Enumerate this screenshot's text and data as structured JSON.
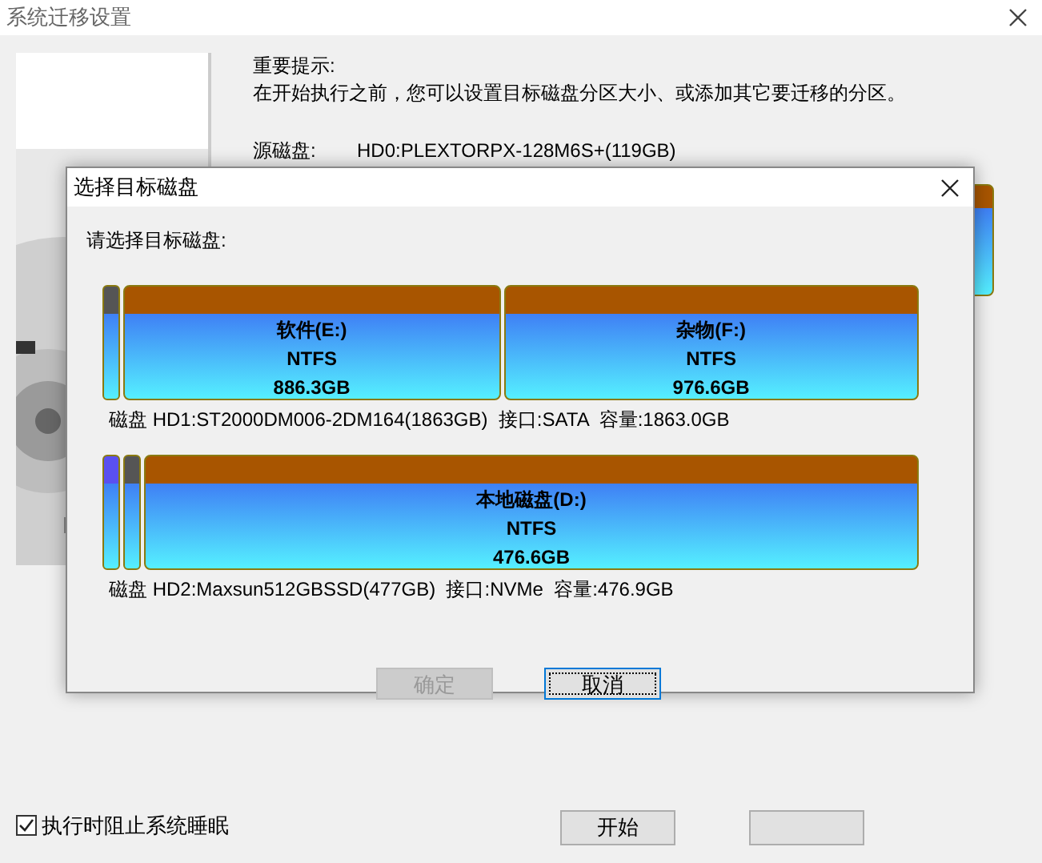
{
  "window": {
    "title": "系统迁移设置"
  },
  "notice": {
    "heading": "重要提示:",
    "text": "在开始执行之前，您可以设置目标磁盘分区大小、或添加其它要迁移的分区。"
  },
  "source": {
    "label": "源磁盘:",
    "value": "HD0:PLEXTORPX-128M6S+(119GB)"
  },
  "dialog": {
    "title": "选择目标磁盘",
    "prompt": "请选择目标磁盘:",
    "disks": [
      {
        "selected": false,
        "info": "磁盘 HD1:ST2000DM006-2DM164(1863GB)  接口:SATA  容量:1863.0GB",
        "partitions": [
          {
            "kind": "sliver",
            "color": "#555555"
          },
          {
            "kind": "partition",
            "name": "软件(E:)",
            "fs": "NTFS",
            "size": "886.3GB"
          },
          {
            "kind": "partition",
            "name": "杂物(F:)",
            "fs": "NTFS",
            "size": "976.6GB"
          }
        ]
      },
      {
        "selected": false,
        "info": "磁盘 HD2:Maxsun512GBSSD(477GB)  接口:NVMe  容量:476.9GB",
        "partitions": [
          {
            "kind": "sliver",
            "color": "#5a50f0"
          },
          {
            "kind": "sliver",
            "color": "#555555"
          },
          {
            "kind": "partition",
            "name": "本地磁盘(D:)",
            "fs": "NTFS",
            "size": "476.6GB"
          }
        ]
      }
    ],
    "buttons": [
      {
        "label": "确定",
        "disabled": true,
        "focused": false
      },
      {
        "label": "取消",
        "disabled": false,
        "focused": true
      }
    ]
  },
  "sleep_option": {
    "label": "执行时阻止系统睡眠",
    "checked": true
  },
  "buttons": [
    {
      "kind": "labeled",
      "label": "开始"
    },
    {
      "kind": "covered"
    }
  ]
}
